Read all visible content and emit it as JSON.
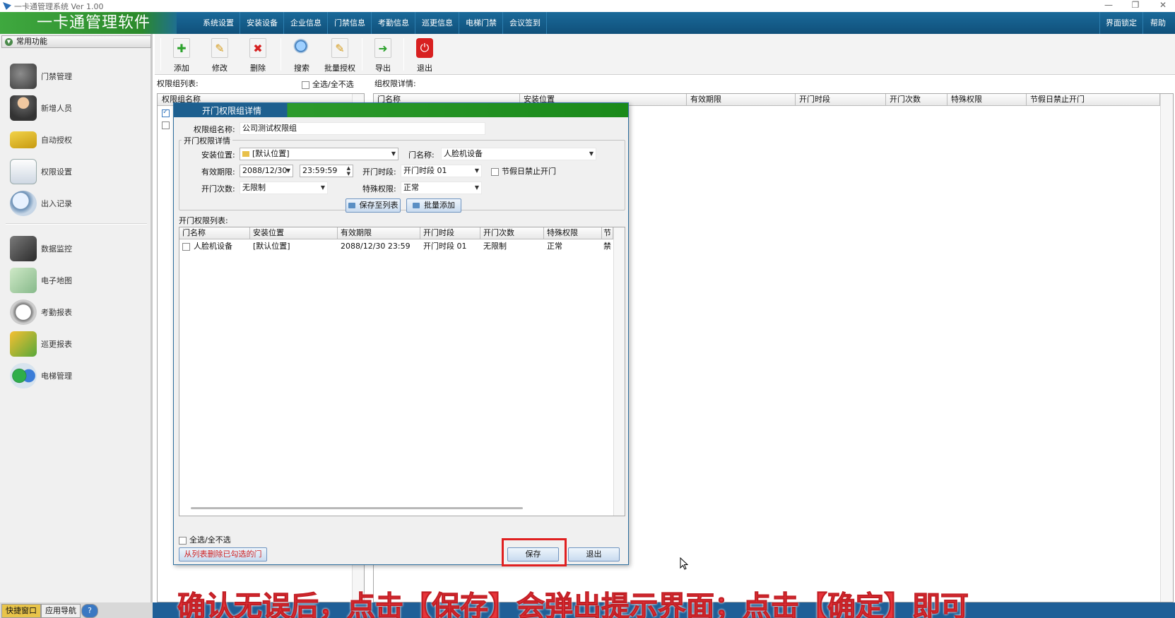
{
  "window": {
    "title": "一卡通管理系统  Ver 1.00",
    "controls": [
      "—",
      "❐",
      "✕"
    ]
  },
  "menubar": {
    "logo": "一卡通管理软件",
    "items": [
      "系统设置",
      "安装设备",
      "企业信息",
      "门禁信息",
      "考勤信息",
      "巡更信息",
      "电梯门禁",
      "会议签到"
    ],
    "right_items": [
      "界面锁定",
      "帮助"
    ]
  },
  "sidebar": {
    "header": "常用功能",
    "items": [
      {
        "label": "门禁管理",
        "icon": "door-access-icon"
      },
      {
        "label": "新增人员",
        "icon": "person-icon"
      },
      {
        "label": "自动授权",
        "icon": "card-icon"
      },
      {
        "label": "权限设置",
        "icon": "document-icon"
      },
      {
        "label": "出入记录",
        "icon": "magnifier-icon"
      },
      {
        "label": "数据监控",
        "icon": "camera-icon"
      },
      {
        "label": "电子地图",
        "icon": "map-icon"
      },
      {
        "label": "考勤报表",
        "icon": "clock-icon"
      },
      {
        "label": "巡更报表",
        "icon": "patrol-icon"
      },
      {
        "label": "电梯管理",
        "icon": "elevator-icon"
      }
    ]
  },
  "bottom_tabs": [
    "快捷窗口",
    "应用导航",
    "?"
  ],
  "toolbar": {
    "buttons": [
      {
        "label": "添加",
        "icon": "add-icon"
      },
      {
        "label": "修改",
        "icon": "edit-icon"
      },
      {
        "label": "删除",
        "icon": "delete-icon"
      },
      {
        "label": "搜索",
        "icon": "search-icon"
      },
      {
        "label": "批量授权",
        "icon": "batch-edit-icon"
      },
      {
        "label": "导出",
        "icon": "export-icon"
      },
      {
        "label": "退出",
        "icon": "power-icon"
      }
    ]
  },
  "group_list": {
    "label": "权限组列表:",
    "select_all": "全选/全不选",
    "column": "权限组名称"
  },
  "group_detail": {
    "label": "组权限详情:",
    "columns": [
      "门名称",
      "安装位置",
      "有效期限",
      "开门时段",
      "开门次数",
      "特殊权限",
      "节假日禁止开门"
    ]
  },
  "dialog": {
    "title": "开门权限组详情",
    "group_name_label": "权限组名称:",
    "group_name_value": "公司测试权限组",
    "section_title": "开门权限详情",
    "location_label": "安装位置:",
    "location_value": "[默认位置]",
    "door_label": "门名称:",
    "door_value": "人脸机设备",
    "validity_label": "有效期限:",
    "validity_date": "2088/12/30",
    "validity_time": "23:59:59",
    "period_label": "开门时段:",
    "period_value": "开门时段 01",
    "holiday_label": "节假日禁止开门",
    "count_label": "开门次数:",
    "count_value": "无限制",
    "special_label": "特殊权限:",
    "special_value": "正常",
    "save_to_list": "保存至列表",
    "batch_add": "批量添加",
    "list_label": "开门权限列表:",
    "table_columns": [
      "门名称",
      "安装位置",
      "有效期限",
      "开门时段",
      "开门次数",
      "特殊权限",
      "节"
    ],
    "rows": [
      [
        "人脸机设备",
        "[默认位置]",
        "2088/12/30 23:59",
        "开门时段 01",
        "无限制",
        "正常",
        "禁"
      ]
    ],
    "select_all": "全选/全不选",
    "remove_checked": "从列表删除已勾选的门",
    "save": "保存",
    "exit": "退出"
  },
  "caption": "确认无误后，点击【保存】会弹出提示界面；点击【确定】即可",
  "colors": {
    "menubar": "#1a6a9a",
    "logo_green": "#3fa83f",
    "highlight_red": "#e02020",
    "caption_red": "#e8343a"
  }
}
